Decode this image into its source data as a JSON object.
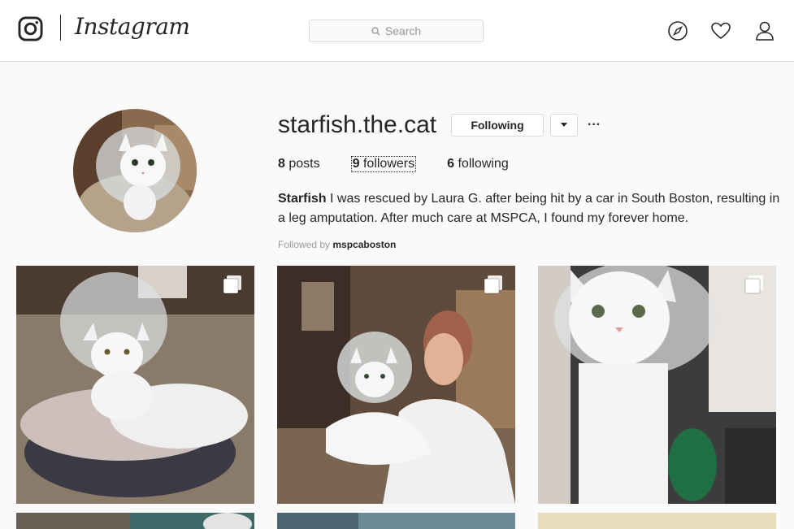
{
  "header": {
    "brand": "Instagram",
    "search": {
      "placeholder": "Search"
    },
    "icons": [
      "instagram-glyph-icon",
      "search-icon",
      "compass-icon",
      "heart-icon",
      "person-icon"
    ]
  },
  "profile": {
    "username": "starfish.the.cat",
    "follow_button": "Following",
    "dropdown_icon": "caret-down-icon",
    "more_label": "···",
    "stats": {
      "posts_count": "8",
      "posts_label": "posts",
      "followers_count": "9",
      "followers_label": "followers",
      "following_count": "6",
      "following_label": "following"
    },
    "bio": {
      "name": "Starfish",
      "text": " I was rescued by Laura G. after being hit by a car in South Boston, resulting in a leg amputation. After much care at MSPCA, I found my forever home."
    },
    "followed_by": {
      "prefix": "Followed by ",
      "user": "mspcaboston"
    }
  },
  "posts": [
    {
      "description": "cat-in-cone-on-bed",
      "multi_icon": "multiple-photos-icon"
    },
    {
      "description": "woman-holding-cat",
      "multi_icon": "multiple-photos-icon"
    },
    {
      "description": "cat-with-cone-cast",
      "multi_icon": "multiple-photos-icon"
    },
    {
      "description": "partial-row"
    },
    {
      "description": "partial-row"
    },
    {
      "description": "partial-row"
    }
  ],
  "colors": {
    "text": "#262626",
    "muted": "#999999",
    "border": "#dbdbdb",
    "background": "#fafafa"
  }
}
